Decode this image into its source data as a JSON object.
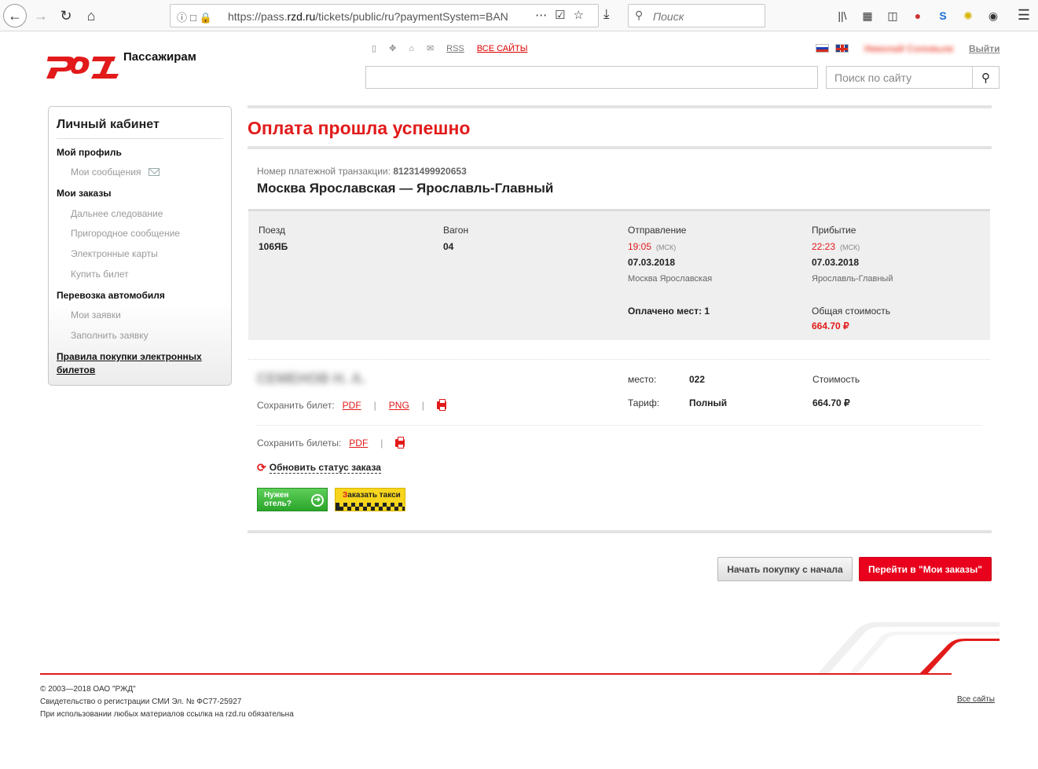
{
  "browser": {
    "url_prefix": "https://pass.",
    "url_domain": "rzd.ru",
    "url_rest": "/tickets/public/ru?paymentSystem=BAN",
    "search_placeholder": "Поиск"
  },
  "header": {
    "brand": "Пассажирам",
    "rss_label": "RSS",
    "all_sites_label": "ВСЕ САЙТЫ",
    "username": "Николай Соловьев",
    "logout_label": "Выйти",
    "site_search_placeholder": "Поиск по сайту"
  },
  "sidebar": {
    "title": "Личный кабинет",
    "profile": "Мой профиль",
    "messages": "Мои сообщения",
    "orders": "Мои заказы",
    "long_distance": "Дальнее следование",
    "suburban": "Пригородное сообщение",
    "cards": "Электронные карты",
    "buy_ticket": "Купить билет",
    "car_transport": "Перевозка автомобиля",
    "my_requests": "Мои заявки",
    "fill_request": "Заполнить заявку",
    "rules": "Правила покупки электронных билетов"
  },
  "main": {
    "title": "Оплата прошла успешно",
    "txn_label": "Номер платежной транзакции:",
    "txn_number": "81231499920653",
    "route": "Москва Ярославская — Ярославль-Главный",
    "trip": {
      "train_label": "Поезд",
      "train": "106ЯБ",
      "car_label": "Вагон",
      "car": "04",
      "departure_label": "Отправление",
      "departure_time": "19:05",
      "departure_tz": "(МСК)",
      "departure_date": "07.03.2018",
      "departure_station": "Москва Ярославская",
      "arrival_label": "Прибытие",
      "arrival_time": "22:23",
      "arrival_tz": "(МСК)",
      "arrival_date": "07.03.2018",
      "arrival_station": "Ярославль-Главный",
      "seats_paid": "Оплачено мест: 1",
      "total_label": "Общая стоимость",
      "total": "664.70 ₽"
    },
    "passenger": {
      "name": "СЕМЕНОВ Н. А.",
      "save_ticket_label": "Сохранить билет:",
      "pdf": "PDF",
      "png": "PNG",
      "seat_label": "место:",
      "seat": "022",
      "tariff_label": "Тариф:",
      "tariff": "Полный",
      "cost_label": "Стоимость",
      "cost": "664.70 ₽"
    },
    "save_tickets_label": "Сохранить билеты:",
    "save_tickets_pdf": "PDF",
    "pipe": "|",
    "refresh_label": "Обновить статус заказа",
    "hotel_banner": "Нужен отель?",
    "taxi_banner_r": "З",
    "taxi_banner": "аказать такси",
    "restart_button": "Начать покупку с начала",
    "orders_button": "Перейти в \"Мои заказы\""
  },
  "footer": {
    "line1": "© 2003—2018 ОАО \"РЖД\"",
    "line2": "Свидетельство о регистрации СМИ Эл. № ФС77-25927",
    "line3": "При использовании любых материалов ссылка на rzd.ru обязательна",
    "all_sites": "Все сайты"
  },
  "colors": {
    "brand_red": "#e21a1a",
    "button_red": "#e8001c"
  },
  "icons": [
    "back-arrow-icon",
    "forward-arrow-icon",
    "reload-icon",
    "home-icon",
    "info-icon",
    "lock-icon",
    "more-icon",
    "pocket-icon",
    "star-icon",
    "download-icon",
    "search-icon",
    "library-icon",
    "sidebar-icon",
    "print-icon",
    "refresh-icon",
    "envelope-icon"
  ]
}
